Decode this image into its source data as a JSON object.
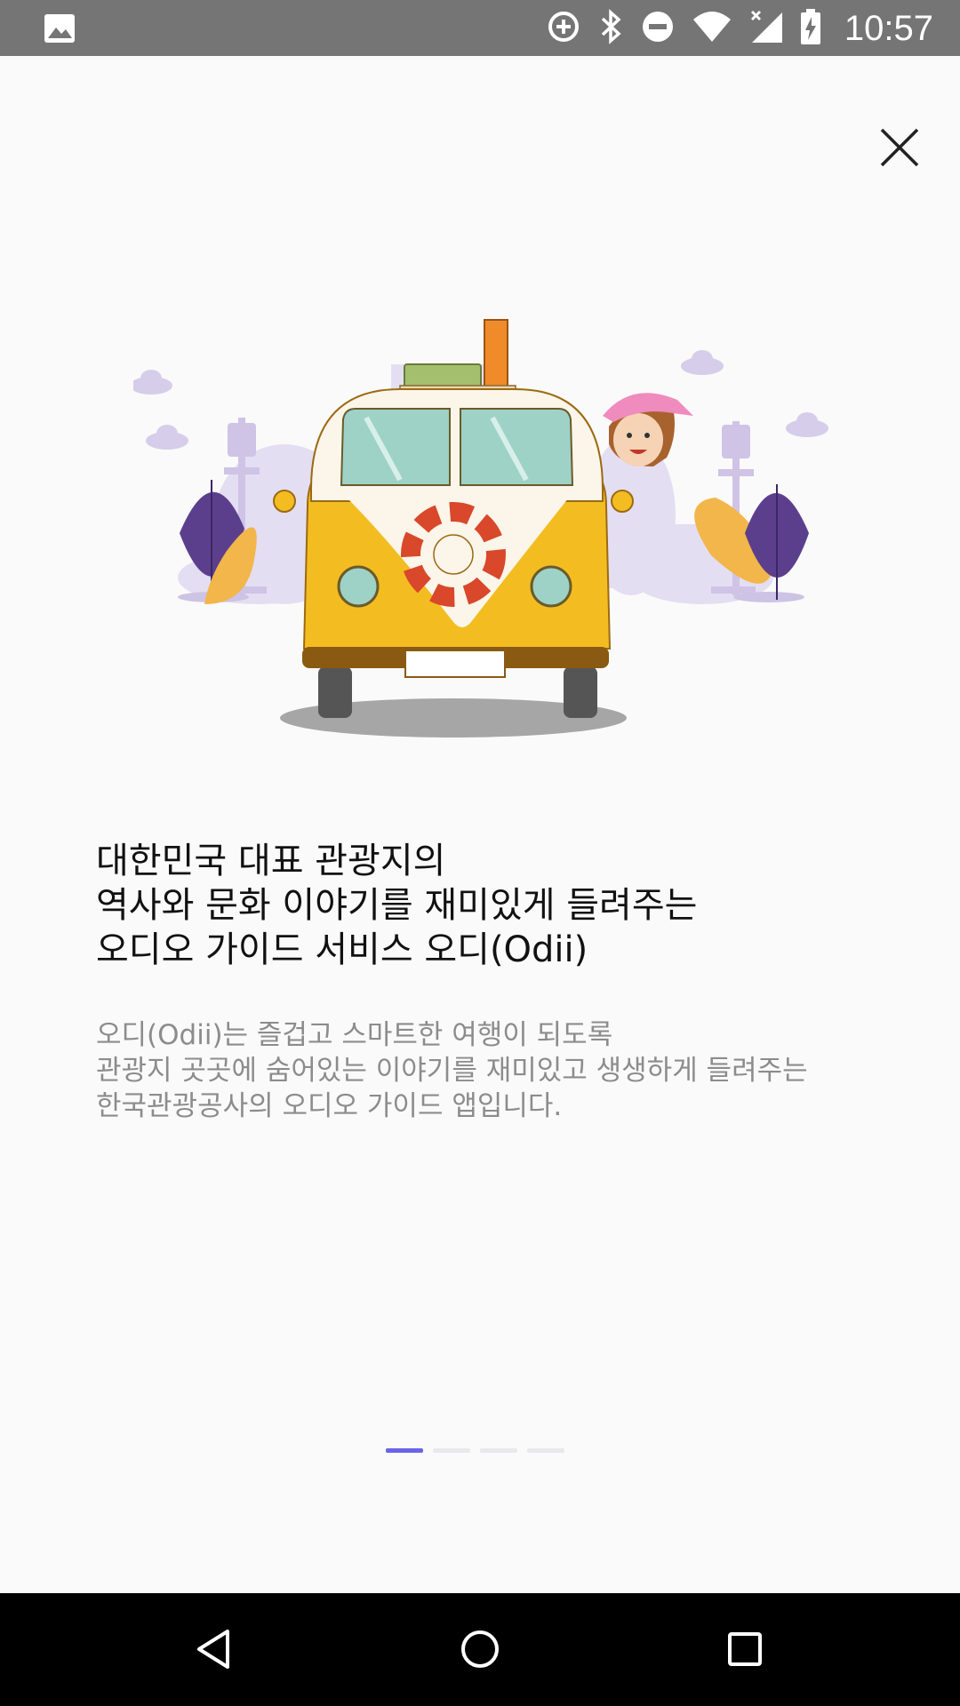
{
  "status_bar": {
    "time": "10:57",
    "icons": [
      "image-icon",
      "data-saver-icon",
      "bluetooth-icon",
      "do-not-disturb-icon",
      "wifi-icon",
      "cell-signal-off-icon",
      "battery-charging-icon"
    ]
  },
  "onboarding": {
    "title": "대한민국 대표 관광지의\n역사와 문화 이야기를 재미있게 들려주는\n오디오 가이드 서비스 오디(Odii)",
    "description": "오디(Odii)는 즐겁고 스마트한 여행이 되도록\n관광지 곳곳에 숨어있는 이야기를 재미있고 생생하게 들려주는\n한국관광공사의 오디오 가이드 앱입니다.",
    "page_count": 4,
    "current_page": 1
  },
  "colors": {
    "background": "#fafafa",
    "status_bar": "#757575",
    "pager_active": "#6c63e8",
    "pager_inactive": "#e9e9eb",
    "title": "#111111",
    "description": "#8c8c8c"
  },
  "nav_bar": {
    "buttons": [
      "back-icon",
      "home-icon",
      "recents-icon"
    ]
  }
}
